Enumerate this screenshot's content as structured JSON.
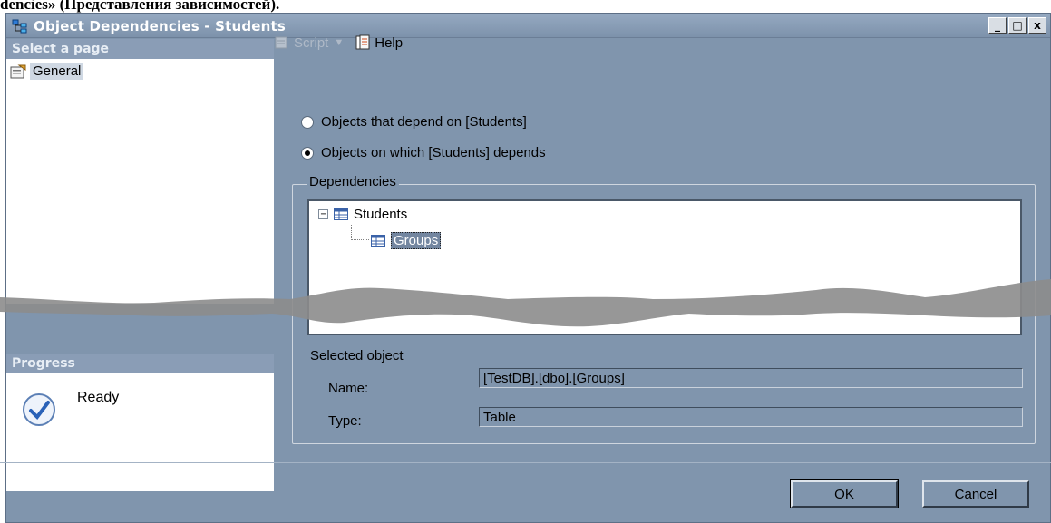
{
  "caption": "dencies» (Представления зависимостей).",
  "window": {
    "title": "Object Dependencies - Students",
    "controls": [
      "_",
      "□",
      "x"
    ]
  },
  "left": {
    "select_page_heading": "Select a page",
    "pages": [
      {
        "label": "General",
        "icon": "properties-icon"
      }
    ],
    "progress_heading": "Progress",
    "status": "Ready"
  },
  "toolbar": {
    "script_label": "Script",
    "help_label": "Help"
  },
  "options": {
    "depend_on": "Objects that depend on [Students]",
    "depends": "Objects on which [Students] depends",
    "selected": "depends"
  },
  "dependencies": {
    "legend": "Dependencies",
    "tree": {
      "root": "Students",
      "children": [
        "Groups"
      ],
      "selected_child": "Groups"
    }
  },
  "selected_object": {
    "title": "Selected object",
    "name_label": "Name:",
    "name_value": "[TestDB].[dbo].[Groups]",
    "type_label": "Type:",
    "type_value": "Table"
  },
  "buttons": {
    "ok": "OK",
    "cancel": "Cancel"
  }
}
